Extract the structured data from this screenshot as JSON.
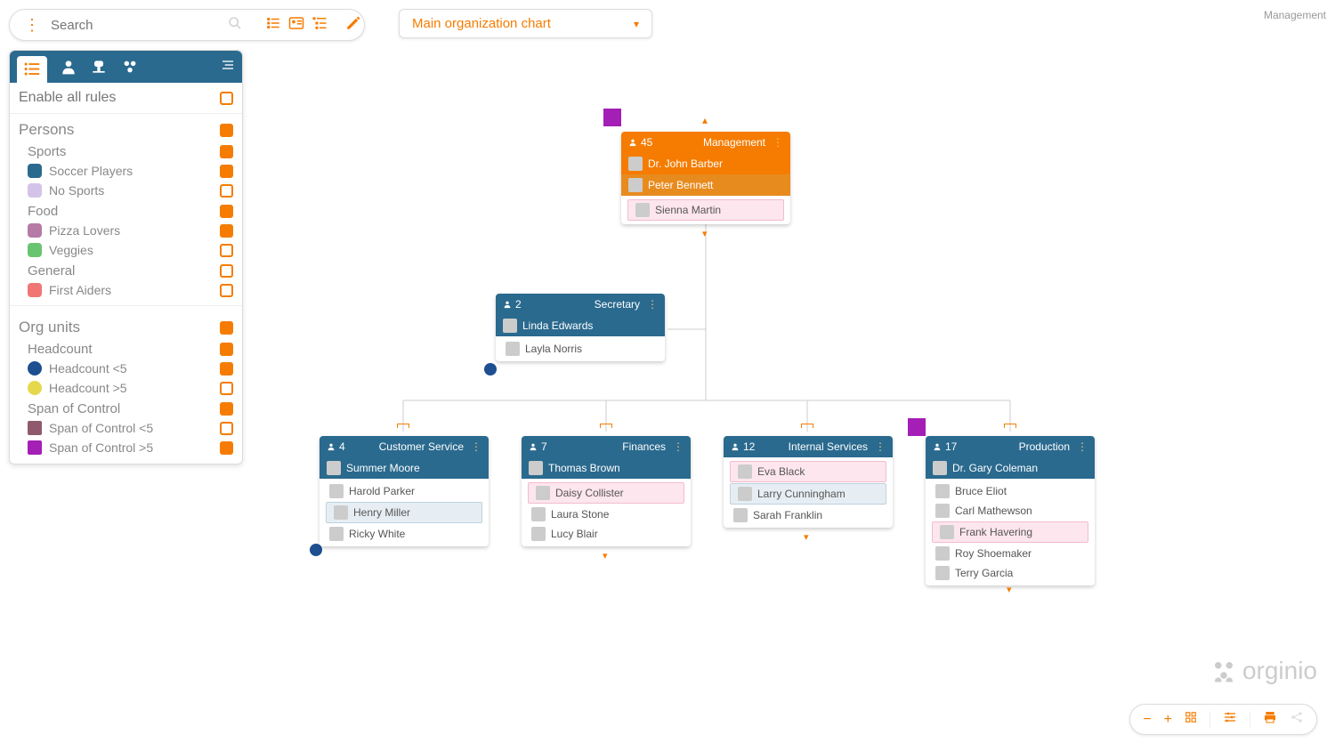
{
  "breadcrumb": "Management",
  "search": {
    "placeholder": "Search"
  },
  "chart_selector": {
    "label": "Main organization chart"
  },
  "panel": {
    "enable_all": "Enable all rules",
    "persons_title": "Persons",
    "sports_title": "Sports",
    "soccer": "Soccer Players",
    "nosports": "No Sports",
    "food_title": "Food",
    "pizza": "Pizza Lovers",
    "veggies": "Veggies",
    "general_title": "General",
    "firstaid": "First Aiders",
    "orgunits_title": "Org units",
    "headcount_title": "Headcount",
    "hc_lt5": "Headcount <5",
    "hc_gt5": "Headcount >5",
    "span_title": "Span of Control",
    "span_lt5": "Span of Control <5",
    "span_gt5": "Span of Control >5"
  },
  "cards": {
    "management": {
      "count": "45",
      "title": "Management",
      "lead1": "Dr. John Barber",
      "lead2": "Peter Bennett",
      "p1": "Sienna Martin"
    },
    "secretary": {
      "count": "2",
      "title": "Secretary",
      "lead": "Linda Edwards",
      "p1": "Layla Norris"
    },
    "cs": {
      "count": "4",
      "title": "Customer Service",
      "lead": "Summer Moore",
      "p1": "Harold Parker",
      "p2": "Henry Miller",
      "p3": "Ricky White"
    },
    "fin": {
      "count": "7",
      "title": "Finances",
      "lead": "Thomas Brown",
      "p1": "Daisy Collister",
      "p2": "Laura Stone",
      "p3": "Lucy Blair"
    },
    "is": {
      "count": "12",
      "title": "Internal Services",
      "p1": "Eva Black",
      "p2": "Larry Cunningham",
      "p3": "Sarah Franklin"
    },
    "prod": {
      "count": "17",
      "title": "Production",
      "lead": "Dr. Gary Coleman",
      "p1": "Bruce Eliot",
      "p2": "Carl Mathewson",
      "p3": "Frank Havering",
      "p4": "Roy Shoemaker",
      "p5": "Terry Garcia"
    }
  },
  "logo": "orginio",
  "colors": {
    "soccer": "#2a6a8e",
    "nosports": "#d4c3e8",
    "pizza": "#b57aa5",
    "veggies": "#69c46f",
    "firstaid": "#f07676",
    "hc_lt5": "#1d4f91",
    "hc_gt5": "#e5d84a",
    "span_lt5": "#8f5a6d",
    "span_gt5": "#a41fb5"
  }
}
